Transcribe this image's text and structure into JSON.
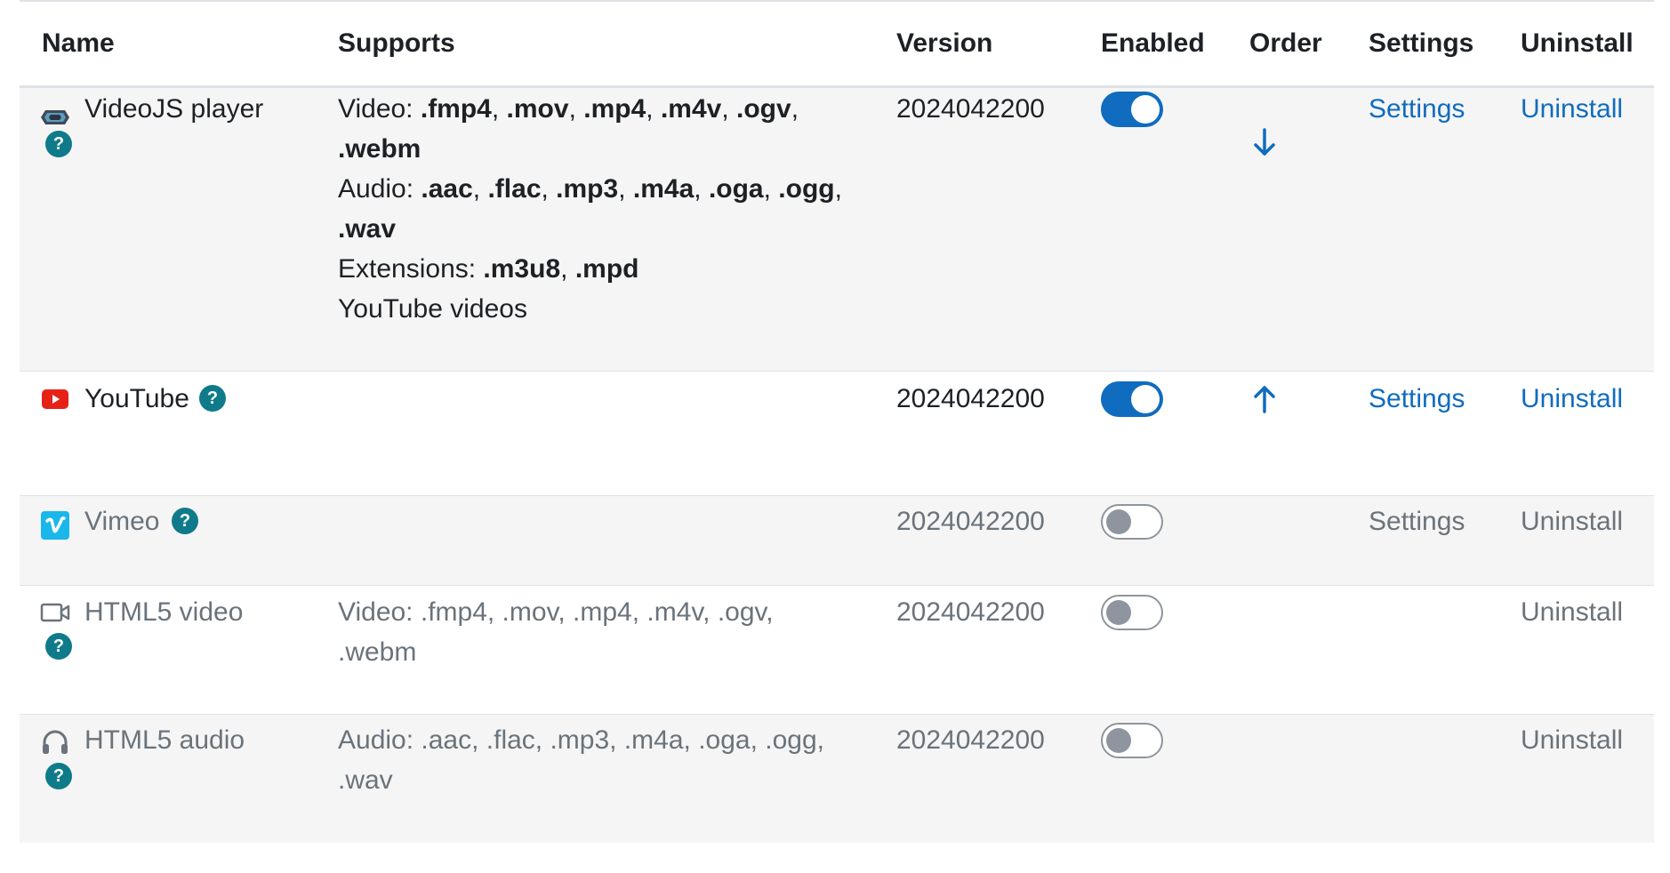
{
  "headers": {
    "name": "Name",
    "supports": "Supports",
    "version": "Version",
    "enabled": "Enabled",
    "order": "Order",
    "settings": "Settings",
    "uninstall": "Uninstall"
  },
  "rows": [
    {
      "name": "VideoJS player",
      "icon": "videojs-icon",
      "supports": {
        "video_label": "Video: ",
        "video_exts": [
          ".fmp4",
          ".mov",
          ".mp4",
          ".m4v",
          ".ogv",
          ".webm"
        ],
        "audio_label": "Audio: ",
        "audio_exts": [
          ".aac",
          ".flac",
          ".mp3",
          ".m4a",
          ".oga",
          ".ogg",
          ".wav"
        ],
        "ext_label": "Extensions: ",
        "ext_exts": [
          ".m3u8",
          ".mpd"
        ],
        "extra": "YouTube videos"
      },
      "version": "2024042200",
      "enabled": true,
      "order": "down",
      "settings": "Settings",
      "uninstall": "Uninstall"
    },
    {
      "name": "YouTube",
      "icon": "youtube-icon",
      "supports": "",
      "version": "2024042200",
      "enabled": true,
      "order": "up",
      "settings": "Settings",
      "uninstall": "Uninstall"
    },
    {
      "name": "Vimeo",
      "icon": "vimeo-icon",
      "supports": "",
      "version": "2024042200",
      "enabled": false,
      "settings": "Settings",
      "uninstall": "Uninstall"
    },
    {
      "name": "HTML5 video",
      "icon": "video-camera-icon",
      "supports": {
        "line1": "Video: .fmp4, .mov, .mp4, .m4v, .ogv,",
        "line2": ".webm"
      },
      "version": "2024042200",
      "enabled": false,
      "uninstall": "Uninstall"
    },
    {
      "name": "HTML5 audio",
      "icon": "headphones-icon",
      "supports": {
        "line1": "Audio: .aac, .flac, .mp3, .m4a, .oga, .ogg,",
        "line2": ".wav"
      },
      "version": "2024042200",
      "enabled": false,
      "uninstall": "Uninstall"
    }
  ],
  "help_icon_glyph": "?",
  "colors": {
    "link": "#0f6cbf",
    "toggle_on": "#0f6cbf",
    "help_badge": "#0f7b8a",
    "muted_text": "#6a737b",
    "youtube_red": "#e62117",
    "vimeo_blue": "#1ab7ea"
  }
}
